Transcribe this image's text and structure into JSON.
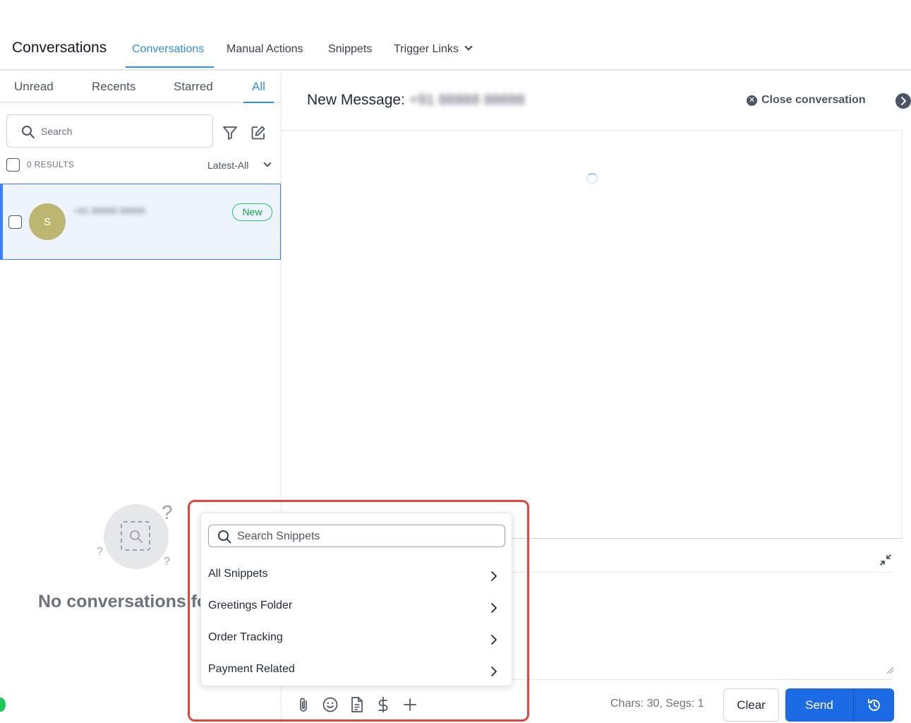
{
  "header": {
    "app_title": "Conversations",
    "tabs": [
      {
        "label": "Conversations",
        "active": true
      },
      {
        "label": "Manual Actions"
      },
      {
        "label": "Snippets"
      },
      {
        "label": "Trigger Links"
      }
    ]
  },
  "left": {
    "subtabs": [
      {
        "label": "Unread"
      },
      {
        "label": "Recents"
      },
      {
        "label": "Starred"
      },
      {
        "label": "All",
        "active": true
      }
    ],
    "search_placeholder": "Search",
    "results_label": "0 RESULTS",
    "sort_label": "Latest-All",
    "conversation": {
      "avatar_initial": "S",
      "name_blurred": "+91 88888 88888",
      "badge": "New"
    },
    "empty_text": "No conversations fo"
  },
  "main": {
    "title_prefix": "New Message:",
    "title_number_blurred": "+91 88888 88888",
    "close_label": "Close conversation",
    "chars_label": "Chars: 30, Segs: 1",
    "clear_label": "Clear",
    "send_label": "Send"
  },
  "snippets": {
    "search_placeholder": "Search Snippets",
    "items": [
      {
        "label": "All Snippets"
      },
      {
        "label": "Greetings Folder"
      },
      {
        "label": "Order Tracking"
      },
      {
        "label": "Payment Related"
      }
    ]
  },
  "colors": {
    "accent": "#2f8fdd",
    "send": "#1d6ae5",
    "badge_green": "#22c55e",
    "highlight": "#e0463a",
    "avatar": "#bdb670"
  }
}
